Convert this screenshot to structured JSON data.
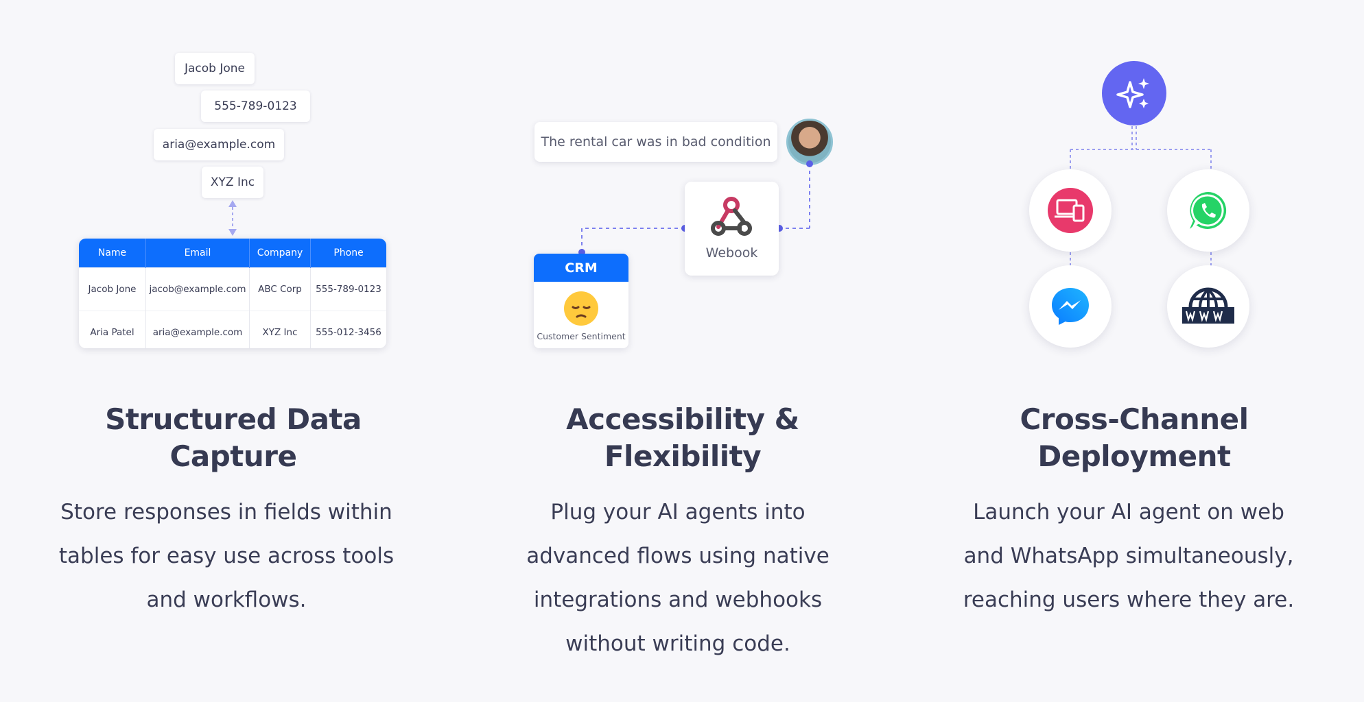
{
  "structured": {
    "chips": [
      "Jacob Jone",
      "555-789-0123",
      "aria@example.com",
      "XYZ Inc"
    ],
    "table": {
      "headers": [
        "Name",
        "Email",
        "Company",
        "Phone"
      ],
      "rows": [
        [
          "Jacob Jone",
          "jacob@example.com",
          "ABC Corp",
          "555-789-0123"
        ],
        [
          "Aria Patel",
          "aria@example.com",
          "XYZ Inc",
          "555-012-3456"
        ]
      ]
    },
    "heading_line1": "Structured Data",
    "heading_line2": "Capture",
    "desc_lines": [
      "Store responses in fields within",
      "tables for easy use across tools",
      "and workflows."
    ]
  },
  "accessibility": {
    "bubble_text": "The rental car was in bad condition",
    "webhook_label": "Webook",
    "crm_title": "CRM",
    "crm_subtitle": "Customer Sentiment",
    "heading_line1": "Accessibility &",
    "heading_line2": "Flexibility",
    "desc_lines": [
      "Plug your AI agents into",
      "advanced flows using native",
      "integrations and webhooks",
      "without writing code."
    ]
  },
  "crosschannel": {
    "icons": [
      "sparkle-icon",
      "device-chat-icon",
      "whatsapp-icon",
      "messenger-icon",
      "www-globe-icon"
    ],
    "heading_line1": "Cross-Channel",
    "heading_line2": "Deployment",
    "desc_lines": [
      "Launch your AI agent on web",
      "and WhatsApp simultaneously,",
      "reaching users where they are."
    ]
  },
  "colors": {
    "primary_blue": "#0d6efd",
    "accent_purple": "#6366f1",
    "text_dark": "#363a52",
    "whatsapp_green": "#25d366",
    "pink": "#e8396b"
  }
}
